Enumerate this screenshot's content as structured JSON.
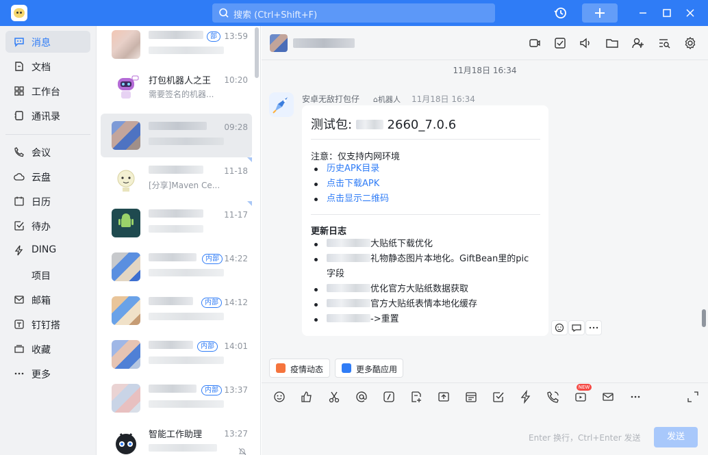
{
  "titlebar": {
    "search_placeholder": "搜索 (Ctrl+Shift+F)",
    "accent_color": "#2f7cf6"
  },
  "nav": {
    "items": [
      {
        "label": "消息",
        "icon": "message-icon",
        "active": true
      },
      {
        "label": "文档",
        "icon": "document-icon"
      },
      {
        "label": "工作台",
        "icon": "grid-icon"
      },
      {
        "label": "通讯录",
        "icon": "contacts-icon"
      },
      {
        "label": "会议",
        "icon": "phone-icon"
      },
      {
        "label": "云盘",
        "icon": "cloud-icon"
      },
      {
        "label": "日历",
        "icon": "calendar-icon"
      },
      {
        "label": "待办",
        "icon": "checkbox-icon"
      },
      {
        "label": "DING",
        "icon": "lightning-icon"
      },
      {
        "label": "项目",
        "icon": ""
      },
      {
        "label": "邮箱",
        "icon": "mail-icon"
      },
      {
        "label": "钉钉搭",
        "icon": "builder-icon"
      },
      {
        "label": "收藏",
        "icon": "favorite-icon"
      },
      {
        "label": "更多",
        "icon": "more-icon"
      }
    ]
  },
  "conversations": [
    {
      "name": "",
      "preview": "",
      "time": "13:59",
      "tag": "部"
    },
    {
      "name": "打包机器人之王",
      "preview": "需要签名的机器...",
      "time": "10:20",
      "tag": ""
    },
    {
      "name": "",
      "preview": "",
      "time": "09:28",
      "tag": ""
    },
    {
      "name": "",
      "preview": "[分享]Maven Ce...",
      "time": "11-18",
      "tag": ""
    },
    {
      "name": "",
      "preview": "",
      "time": "11-17",
      "tag": ""
    },
    {
      "name": "",
      "preview": "",
      "time": "14:22",
      "tag": "内部"
    },
    {
      "name": "",
      "preview": "",
      "time": "14:12",
      "tag": "内部"
    },
    {
      "name": "",
      "preview": "",
      "time": "14:01",
      "tag": "内部"
    },
    {
      "name": "",
      "preview": "",
      "time": "13:37",
      "tag": "内部"
    },
    {
      "name": "智能工作助理",
      "preview": "",
      "time": "13:27",
      "tag": ""
    }
  ],
  "chat": {
    "date_separator": "11月18日 16:34",
    "message": {
      "sender": "安卓无敌打包仔",
      "robot_label": "机器人",
      "time": "11月18日 16:34",
      "title_prefix": "测试包:",
      "title_suffix": "2660_7.0.6",
      "note": "注意：仅支持内网环境",
      "links": [
        "历史APK目录",
        "点击下载APK",
        "点击显示二维码"
      ],
      "changelog_title": "更新日志",
      "changelog": [
        "大贴纸下载优化",
        "礼物静态图片本地化。GiftBean里的pic",
        "字段",
        "优化官方大贴纸数据获取",
        "官方大贴纸表情本地化缓存",
        "->重置"
      ]
    },
    "apps": [
      "疫情动态",
      "更多酷应用"
    ],
    "composer": {
      "hint": "Enter 换行，Ctrl+Enter 发送",
      "send_label": "发送",
      "new_badge": "NEW"
    }
  }
}
